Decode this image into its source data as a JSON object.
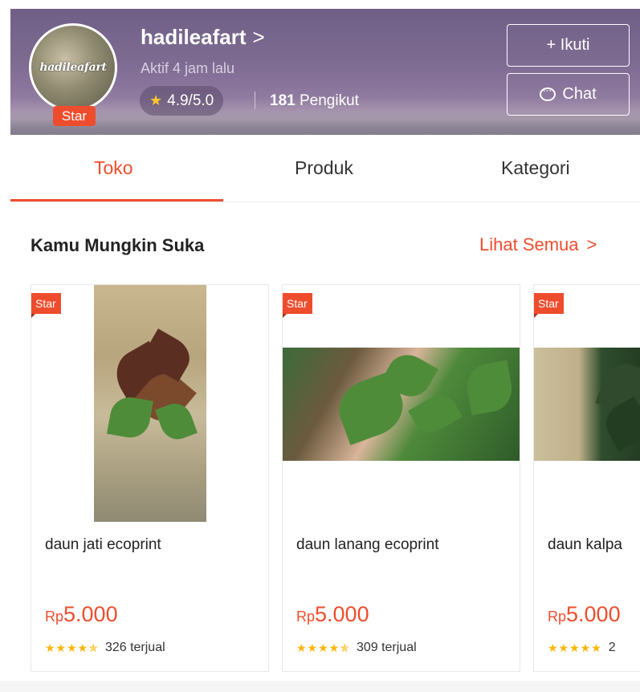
{
  "shop": {
    "avatar_text": "hadileafart",
    "avatar_badge": "Star",
    "name": "hadileafart",
    "name_chevron": ">",
    "status": "Aktif 4 jam lalu",
    "rating": "4.9/5.0",
    "followers_count": "181",
    "followers_label": "Pengikut",
    "follow_label": "+ Ikuti",
    "chat_label": "Chat"
  },
  "tabs": [
    {
      "label": "Toko",
      "active": true
    },
    {
      "label": "Produk",
      "active": false
    },
    {
      "label": "Kategori",
      "active": false
    }
  ],
  "section": {
    "title": "Kamu Mungkin Suka",
    "see_all": "Lihat Semua",
    "see_all_chevron": ">"
  },
  "products": [
    {
      "badge": "Star",
      "name": "daun jati ecoprint",
      "currency": "Rp",
      "price": "5.000",
      "stars": "★★★★✯",
      "rating": 4.5,
      "sold": "326 terjual"
    },
    {
      "badge": "Star",
      "name": "daun lanang ecoprint",
      "currency": "Rp",
      "price": "5.000",
      "stars": "★★★★✯",
      "rating": 4.5,
      "sold": "309 terjual"
    },
    {
      "badge": "Star",
      "name": "daun kalpa",
      "currency": "Rp",
      "price": "5.000",
      "stars": "★★★★★",
      "rating": 5,
      "sold": "2"
    }
  ],
  "colors": {
    "accent": "#ee4d2d",
    "star": "#ffb400"
  }
}
